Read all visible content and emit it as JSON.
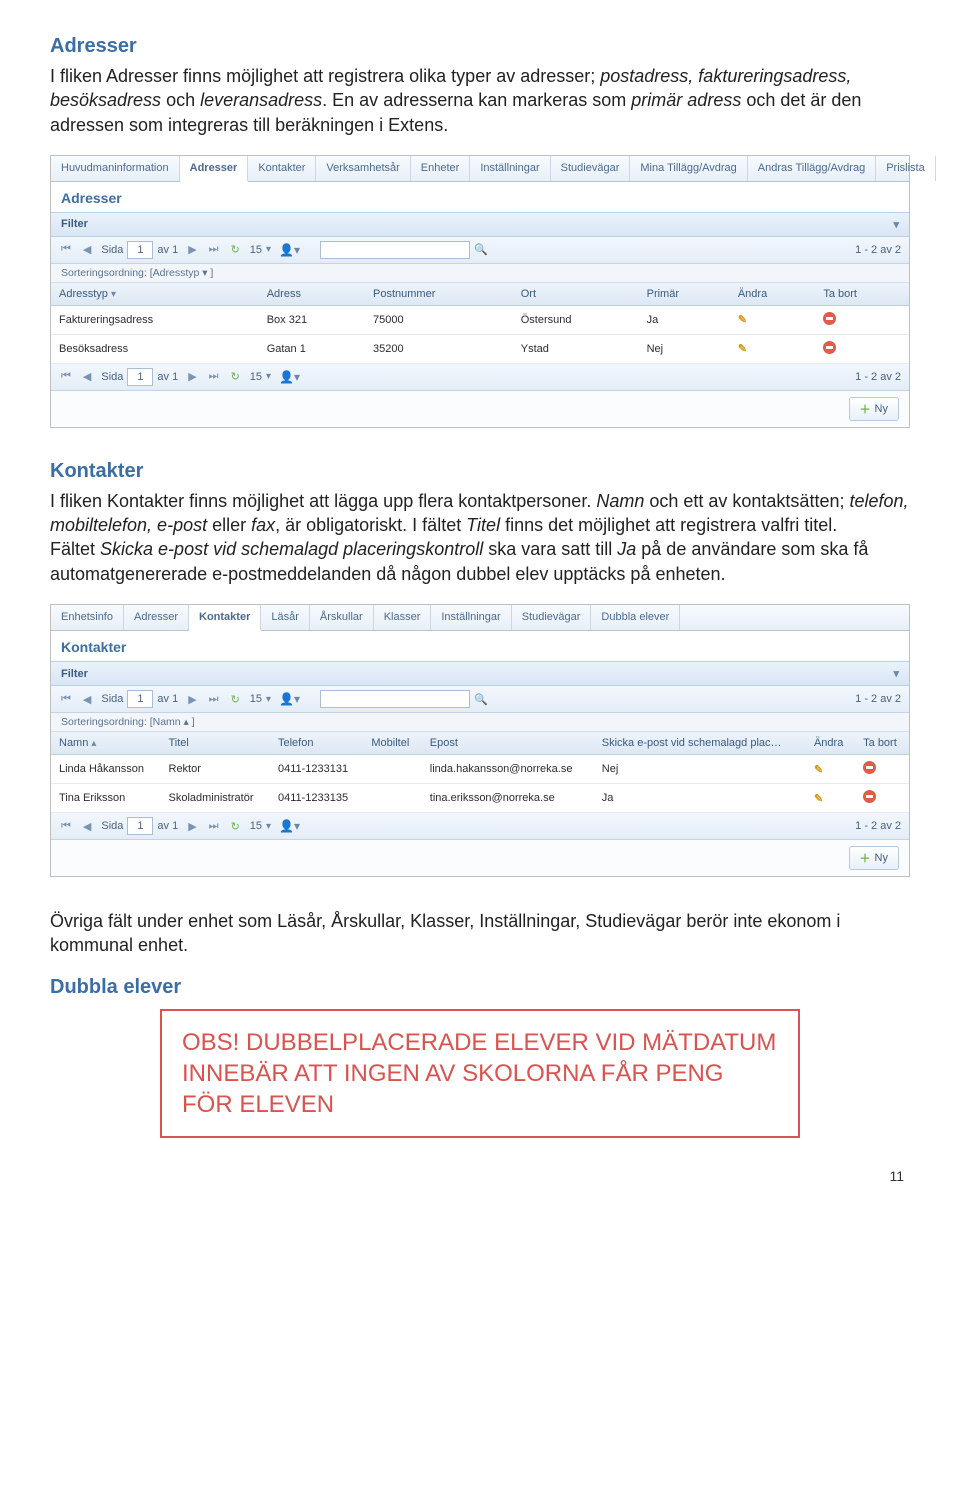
{
  "s1": {
    "heading": "Adresser",
    "para": "I fliken Adresser finns möjlighet att registrera olika typer av adresser; postadress, faktureringsadress, besöksadress och leveransadress. En av adresserna kan markeras som primär adress och det är den adressen som integreras till beräkningen i Extens."
  },
  "shot1": {
    "tabs": [
      "Huvudmaninformation",
      "Adresser",
      "Kontakter",
      "Verksamhetsår",
      "Enheter",
      "Inställningar",
      "Studievägar",
      "Mina Tillägg/Avdrag",
      "Andras Tillägg/Avdrag",
      "Prislista"
    ],
    "active_tab": 1,
    "panel_title": "Adresser",
    "filter": "Filter",
    "side_label": "Sida",
    "page": "1",
    "av": "av 1",
    "per": "15",
    "count": "1 - 2 av 2",
    "sort": "Sorteringsordning: [Adresstyp ▾ ]",
    "cols": [
      "Adresstyp",
      "Adress",
      "Postnummer",
      "Ort",
      "Primär",
      "Ändra",
      "Ta bort"
    ],
    "rows": [
      {
        "typ": "Faktureringsadress",
        "adress": "Box 321",
        "postnr": "75000",
        "ort": "Östersund",
        "primar": "Ja"
      },
      {
        "typ": "Besöksadress",
        "adress": "Gatan 1",
        "postnr": "35200",
        "ort": "Ystad",
        "primar": "Nej"
      }
    ],
    "ny": "Ny"
  },
  "s2": {
    "heading": "Kontakter",
    "para": "I fliken Kontakter finns möjlighet att lägga upp flera kontaktpersoner. Namn och ett av kontaktsätten; telefon, mobiltelefon, e-post eller fax, är obligatoriskt. I fältet Titel finns det möjlighet att registrera valfri titel.\nFältet Skicka e-post vid schemalagd placeringskontroll ska vara satt till Ja på de användare som ska få automatgenererade e-postmeddelanden då någon dubbel elev upptäcks på enheten."
  },
  "shot2": {
    "tabs": [
      "Enhetsinfo",
      "Adresser",
      "Kontakter",
      "Läsår",
      "Årskullar",
      "Klasser",
      "Inställningar",
      "Studievägar",
      "Dubbla elever"
    ],
    "active_tab": 2,
    "panel_title": "Kontakter",
    "filter": "Filter",
    "side_label": "Sida",
    "page": "1",
    "av": "av 1",
    "per": "15",
    "count": "1 - 2 av 2",
    "sort": "Sorteringsordning: [Namn ▴ ]",
    "cols": [
      "Namn",
      "Titel",
      "Telefon",
      "Mobiltel",
      "Epost",
      "Skicka e-post vid schemalagd plac…",
      "Ändra",
      "Ta bort"
    ],
    "rows": [
      {
        "namn": "Linda Håkansson",
        "titel": "Rektor",
        "tel": "0411-1233131",
        "mob": "",
        "epost": "linda.hakansson@norreka.se",
        "skicka": "Nej"
      },
      {
        "namn": "Tina Eriksson",
        "titel": "Skoladministratör",
        "tel": "0411-1233135",
        "mob": "",
        "epost": "tina.eriksson@norreka.se",
        "skicka": "Ja"
      }
    ],
    "ny": "Ny"
  },
  "s3": {
    "para": "Övriga fält under enhet som Läsår, Årskullar, Klasser, Inställningar, Studievägar berör inte ekonom i kommunal enhet."
  },
  "s4": {
    "heading": "Dubbla elever",
    "obs": "OBS! DUBBELPLACERADE ELEVER VID MÄTDATUM INNEBÄR ATT INGEN AV SKOLORNA FÅR PENG FÖR ELEVEN"
  },
  "page_number": "11"
}
